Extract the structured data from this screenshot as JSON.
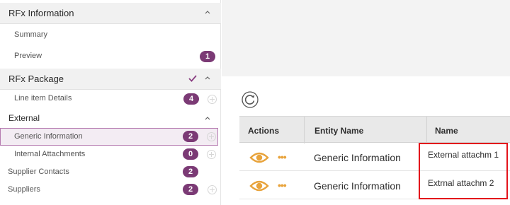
{
  "sidebar": {
    "rfx_information": {
      "title": "RFx Information"
    },
    "summary": {
      "label": "Summary"
    },
    "preview": {
      "label": "Preview",
      "badge": "1"
    },
    "rfx_package": {
      "title": "RFx Package"
    },
    "line_item_details": {
      "label": "Line item Details",
      "badge": "4"
    },
    "external": {
      "title": "External"
    },
    "generic_information": {
      "label": "Generic Information",
      "badge": "2"
    },
    "internal_attachments": {
      "label": "Internal Attachments",
      "badge": "0"
    },
    "supplier_contacts": {
      "label": "Supplier Contacts",
      "badge": "2"
    },
    "suppliers": {
      "label": "Suppliers",
      "badge": "2"
    }
  },
  "table": {
    "headers": {
      "actions": "Actions",
      "entity_name": "Entity Name",
      "name": "Name"
    },
    "rows": [
      {
        "entity_name": "Generic Information",
        "name": "External attachm 1",
        "more_glyph": "•••"
      },
      {
        "entity_name": "Generic Information",
        "name": "Extrnal attachm 2",
        "more_glyph": "•••"
      }
    ]
  },
  "colors": {
    "accent_purple": "#7b3a75",
    "action_orange": "#e8a33b",
    "highlight_red": "#e3131b"
  },
  "icons": {
    "collapse": "chevron-up-icon",
    "refresh": "refresh-icon",
    "view": "eye-icon",
    "more": "more-dots-icon",
    "add": "plus-circle-icon",
    "complete": "check-icon"
  }
}
